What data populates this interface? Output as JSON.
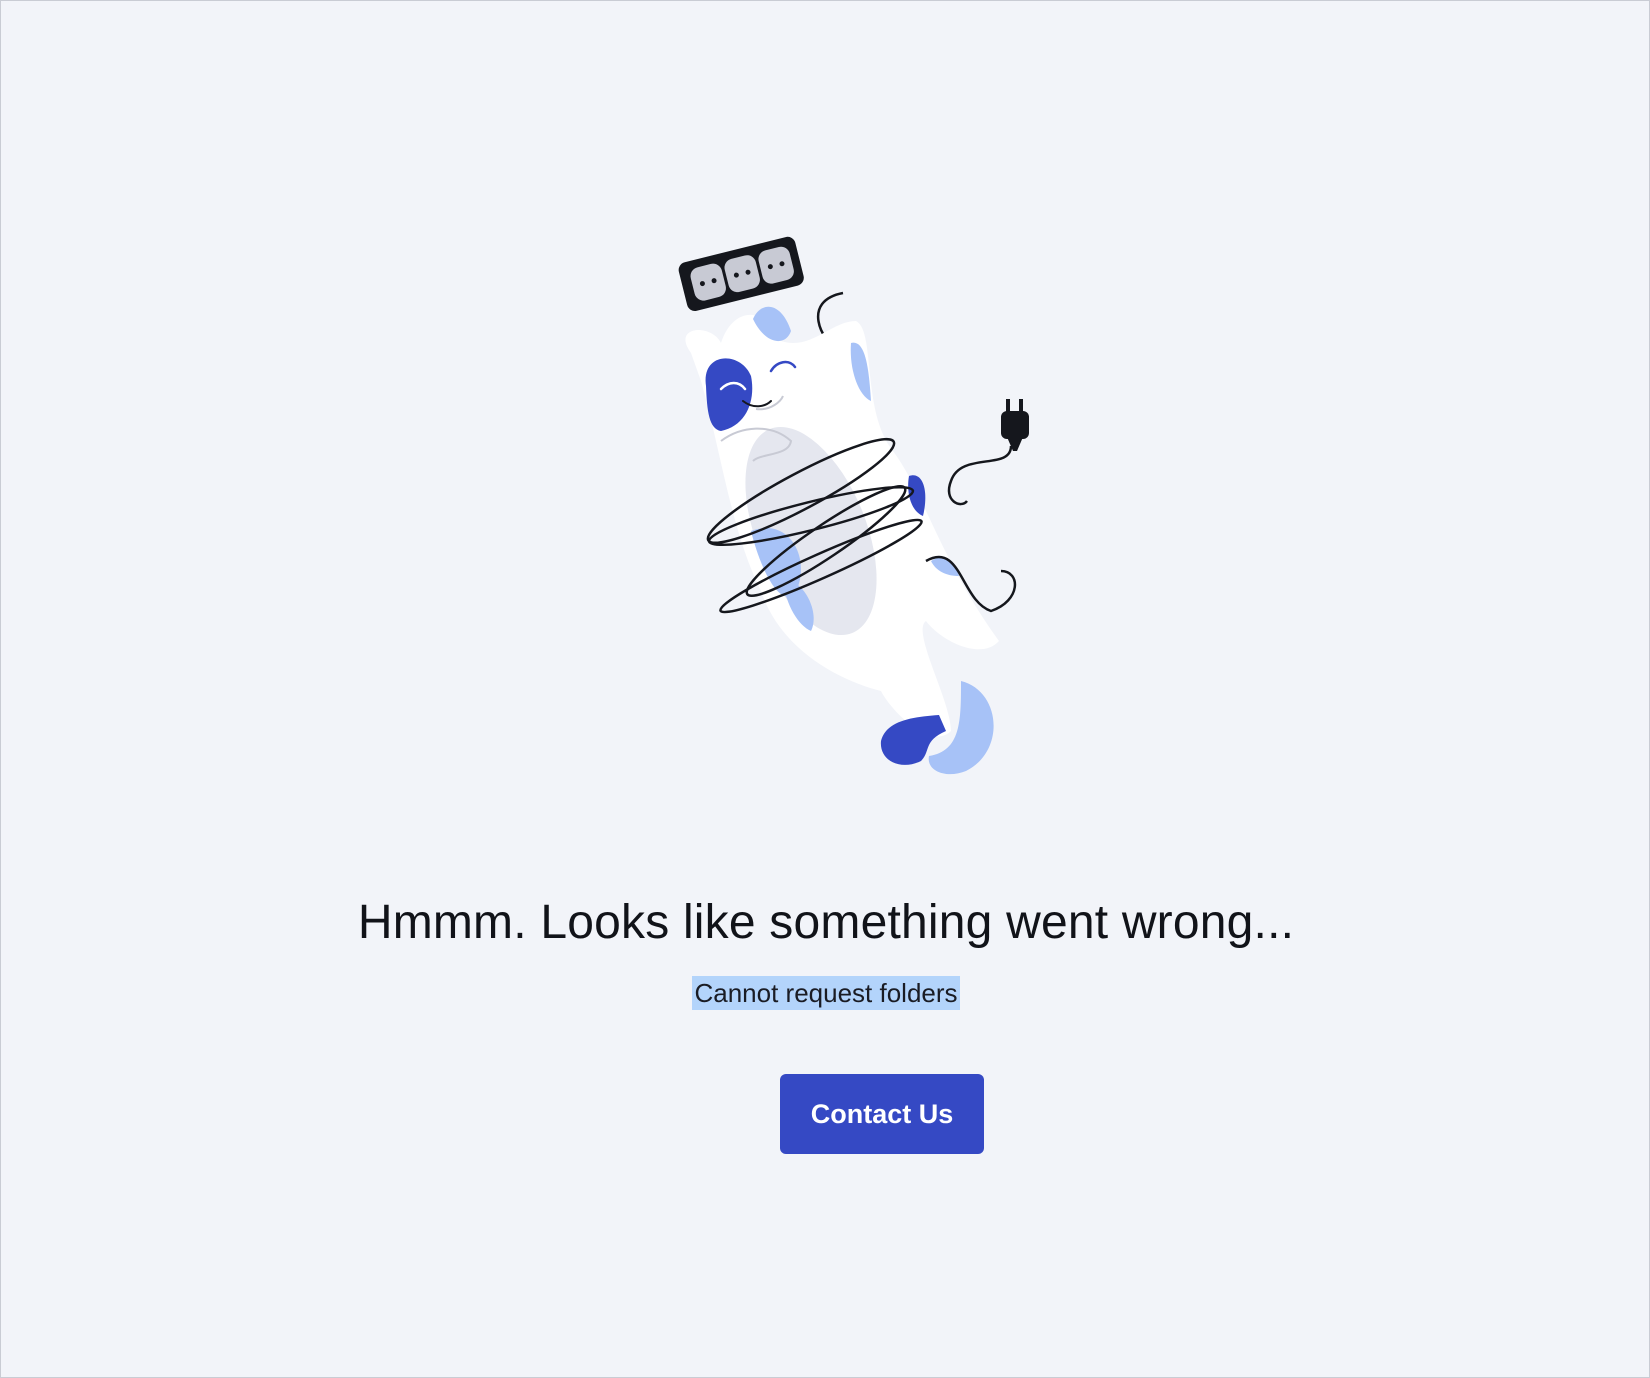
{
  "error": {
    "title": "Hmmm. Looks like something went wrong...",
    "message": "Cannot request folders"
  },
  "actions": {
    "contact_label": "Contact Us"
  },
  "colors": {
    "background": "#f2f4f9",
    "accent": "#3549c4",
    "light_accent": "#a7c2f7",
    "selection": "#b3d4fb"
  },
  "illustration": {
    "icon": "cat-tangled-in-power-cord-illustration"
  }
}
